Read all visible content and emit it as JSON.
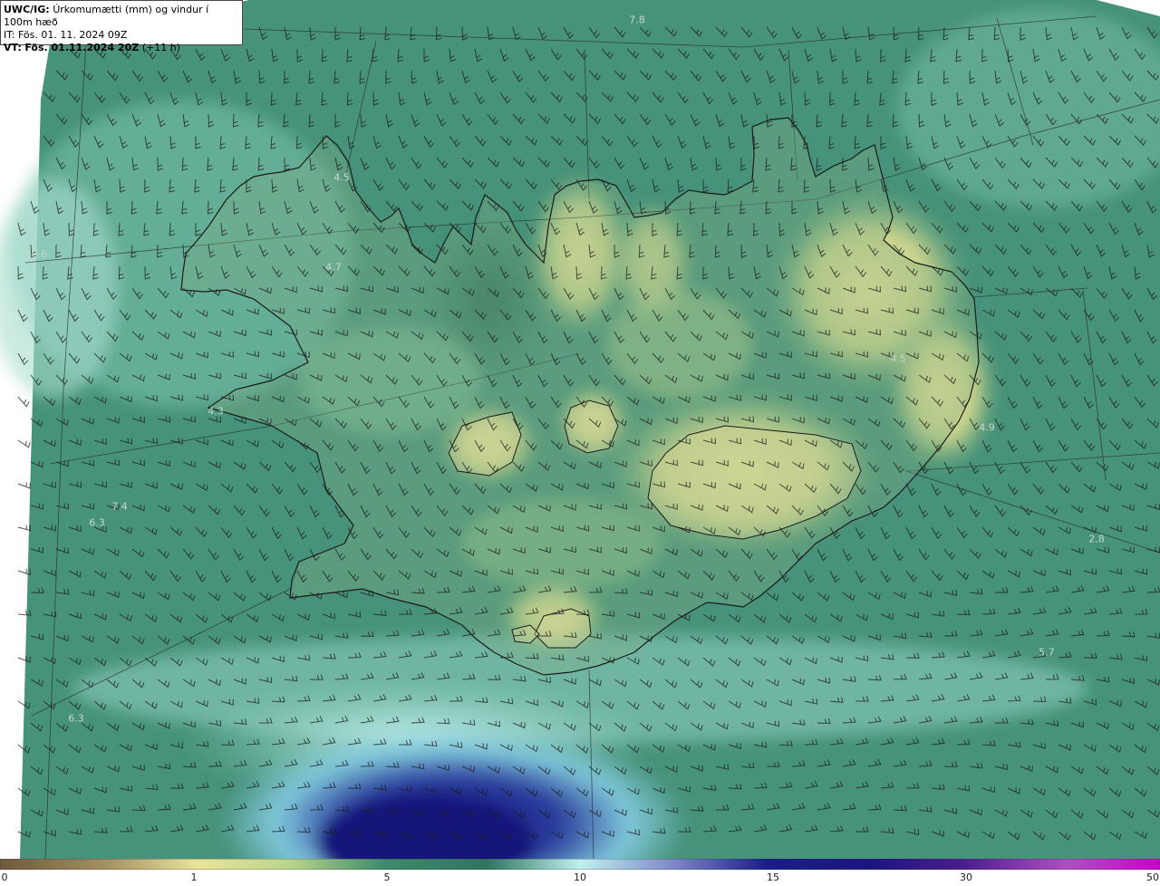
{
  "header": {
    "model": "UWC/IG:",
    "title": "Úrkomumætti (mm) og vindur í 100m hæð",
    "issue_prefix": "IT:",
    "issue_time": "Fös. 01. 11. 2024 09Z",
    "valid_prefix": "VT:",
    "valid_time": "Fös. 01.11.2024 20Z",
    "lead": "(+11 h)"
  },
  "colorbar": {
    "ticks": [
      "0",
      "1",
      "5",
      "10",
      "15",
      "30",
      "50"
    ],
    "colors": [
      "#6e5a3c",
      "#a48e62",
      "#e9e39a",
      "#b9d58a",
      "#3f8b6a",
      "#2f7560",
      "#6fb9a5",
      "#bff0ee",
      "#7e89c9",
      "#1a1e8a",
      "#4b1d8f",
      "#b04fc3",
      "#cc00cc"
    ]
  },
  "map": {
    "value_labels": [
      {
        "id": "v1",
        "text": "7.8"
      },
      {
        "id": "v2",
        "text": "4.5"
      },
      {
        "id": "v3",
        "text": "10.6"
      },
      {
        "id": "v4",
        "text": "4.7"
      },
      {
        "id": "v5",
        "text": "4.3"
      },
      {
        "id": "v6",
        "text": "7.4"
      },
      {
        "id": "v7",
        "text": "6.3"
      },
      {
        "id": "v8",
        "text": "4.5"
      },
      {
        "id": "v9",
        "text": "4.9"
      },
      {
        "id": "v10",
        "text": "2.8"
      },
      {
        "id": "v11",
        "text": "5.7"
      },
      {
        "id": "v12",
        "text": "6.3"
      }
    ],
    "colors": {
      "ocean_teal": "#3f8a72",
      "dry_yellow": "#e8e29a",
      "wet_cyan": "#b4ecea",
      "heavy_blue": "#1a1e8a",
      "coastline": "#1b1b1b",
      "grid": "#333333"
    }
  }
}
